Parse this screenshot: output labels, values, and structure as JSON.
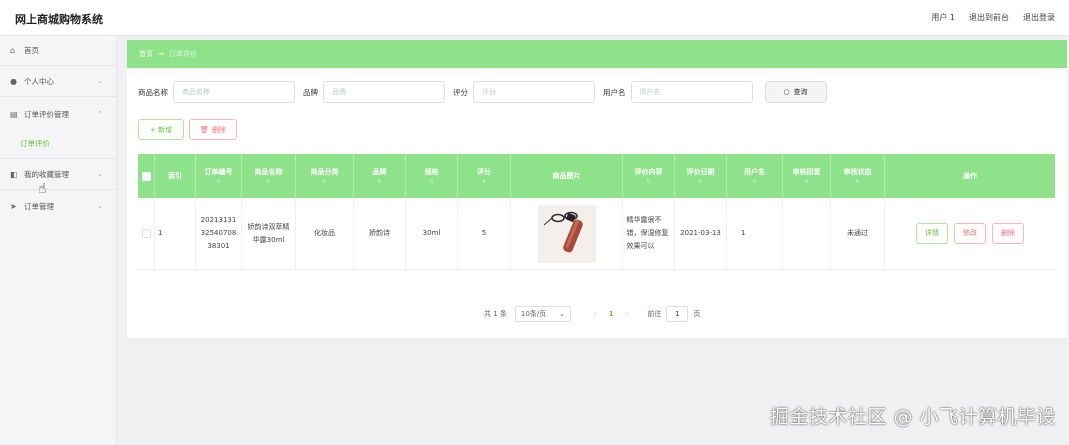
{
  "app": {
    "title": "网上商城购物系统"
  },
  "topbar": {
    "user": "用户 1",
    "to_front": "退出到前台",
    "logout": "退出登录"
  },
  "sidebar": {
    "home": "首页",
    "personal": "个人中心",
    "review_mgmt": "订单评价管理",
    "review_sub": "订单评价",
    "favorites": "我的收藏管理",
    "orders": "订单管理"
  },
  "breadcrumb": {
    "home": "首页",
    "arrow": "→",
    "current": "订单评价"
  },
  "search": {
    "product_label": "商品名称",
    "product_placeholder": "商品名称",
    "brand_label": "品牌",
    "brand_placeholder": "品牌",
    "rating_label": "评分",
    "rating_placeholder": "评分",
    "user_label": "用户名",
    "user_placeholder": "用户名",
    "query_button": "查询"
  },
  "actions": {
    "add": "+ 新增",
    "delete": "删除"
  },
  "table": {
    "headers": [
      "索引",
      "订单编号",
      "商品名称",
      "商品分类",
      "品牌",
      "规格",
      "评分",
      "商品图片",
      "评价内容",
      "评价日期",
      "用户名",
      "审核回复",
      "审核状态",
      "操作"
    ],
    "rows": [
      {
        "index": "1",
        "order_no": "202131313254070838301",
        "product": "娇韵诗双萃精华露30ml",
        "category": "化妆品",
        "brand": "娇韵诗",
        "spec": "30ml",
        "rating": "5",
        "image": "lip-product-image",
        "content": "精华露很不错，保湿修复效果可以",
        "date": "2021-03-13",
        "user": "1",
        "reply": "",
        "status": "未通过",
        "btn_detail": "详情",
        "btn_edit": "修改",
        "btn_delete": "删除"
      }
    ]
  },
  "pagination": {
    "total": "共 1 条",
    "page_size": "10条/页",
    "current": "1",
    "goto_label": "前往",
    "goto_value": "1",
    "page_unit": "页"
  },
  "watermark": "掘金技术社区 @ 小飞计算机毕设",
  "colors": {
    "accent": "#8ee28a",
    "success": "#67c23a",
    "danger": "#f56c6c"
  }
}
